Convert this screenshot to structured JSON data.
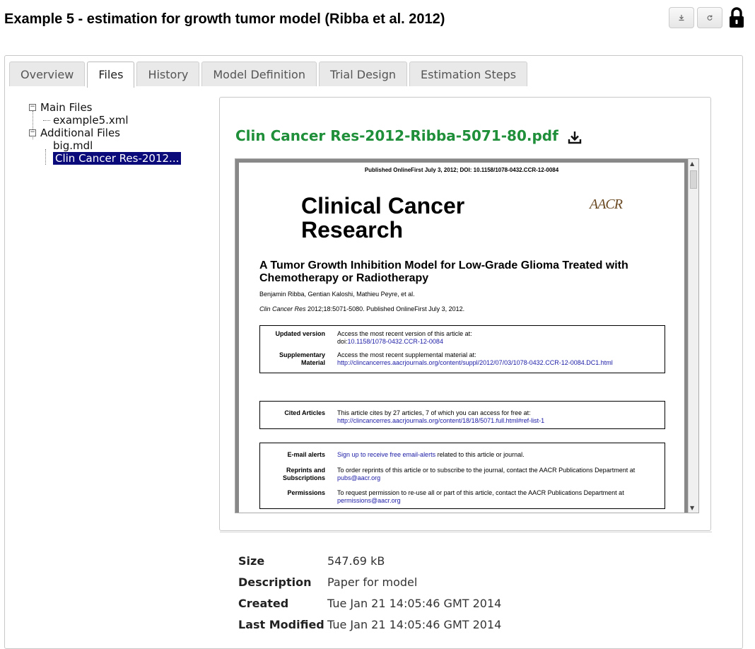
{
  "page": {
    "title": "Example 5 - estimation for growth tumor model (Ribba et al. 2012)"
  },
  "actions": {
    "download_icon": "download-icon",
    "sync_icon": "sync-icon",
    "lock_icon": "lock-icon"
  },
  "tabs": [
    {
      "label": "Overview"
    },
    {
      "label": "Files",
      "active": true
    },
    {
      "label": "History"
    },
    {
      "label": "Model Definition"
    },
    {
      "label": "Trial Design"
    },
    {
      "label": "Estimation Steps"
    }
  ],
  "tree": {
    "main_files": "Main Files",
    "main_children": [
      "example5.xml"
    ],
    "additional_files": "Additional Files",
    "additional_children": [
      "big.mdl",
      "Clin Cancer Res-2012..."
    ]
  },
  "viewer": {
    "file_title": "Clin Cancer Res-2012-Ribba-5071-80.pdf",
    "pdf": {
      "published_line": "Published OnlineFirst July 3, 2012; DOI: 10.1158/1078-0432.CCR-12-0084",
      "journal_line1": "Clinical Cancer",
      "journal_line2": "Research",
      "logo": "AACR",
      "article_title": "A Tumor Growth Inhibition Model for Low-Grade Glioma Treated with Chemotherapy or Radiotherapy",
      "authors": "Benjamin Ribba, Gentian Kaloshi, Mathieu Peyre, et al.",
      "citation_journal": "Clin Cancer Res",
      "citation_rest": " 2012;18:5071-5080. Published OnlineFirst July 3, 2012.",
      "updated_label": "Updated version",
      "updated_text": "Access the most recent version of this article at:",
      "updated_prefix": "doi:",
      "updated_link": "10.1158/1078-0432.CCR-12-0084",
      "supp_label": "Supplementary Material",
      "supp_text": "Access the most recent supplemental material at:",
      "supp_link": "http://clincancerres.aacrjournals.org/content/suppl/2012/07/03/1078-0432.CCR-12-0084.DC1.html",
      "cited_label": "Cited Articles",
      "cited_text": "This article cites by 27 articles, 7 of which you can access for free at:",
      "cited_link": "http://clincancerres.aacrjournals.org/content/18/18/5071.full.html#ref-list-1",
      "email_label": "E-mail alerts",
      "email_link": "Sign up to receive free email-alerts",
      "email_rest": " related to this article or journal.",
      "reprints_label": "Reprints and Subscriptions",
      "reprints_text": "To order reprints of this article or to subscribe to the journal, contact the AACR Publications Department at",
      "reprints_link": "pubs@aacr.org",
      "permissions_label": "Permissions",
      "permissions_text": "To request permission to re-use all or part of this article, contact the AACR Publications Department at",
      "permissions_link": "permissions@aacr.org"
    }
  },
  "meta": {
    "size_label": "Size",
    "size_value": "547.69 kB",
    "description_label": "Description",
    "description_value": "Paper for model",
    "created_label": "Created",
    "created_value": "Tue Jan 21 14:05:46 GMT 2014",
    "modified_label": "Last Modified",
    "modified_value": "Tue Jan 21 14:05:46 GMT 2014"
  },
  "colors": {
    "file_title": "#1f8f3a",
    "selection": "#0a0a7a",
    "link": "#1a1aa6"
  }
}
